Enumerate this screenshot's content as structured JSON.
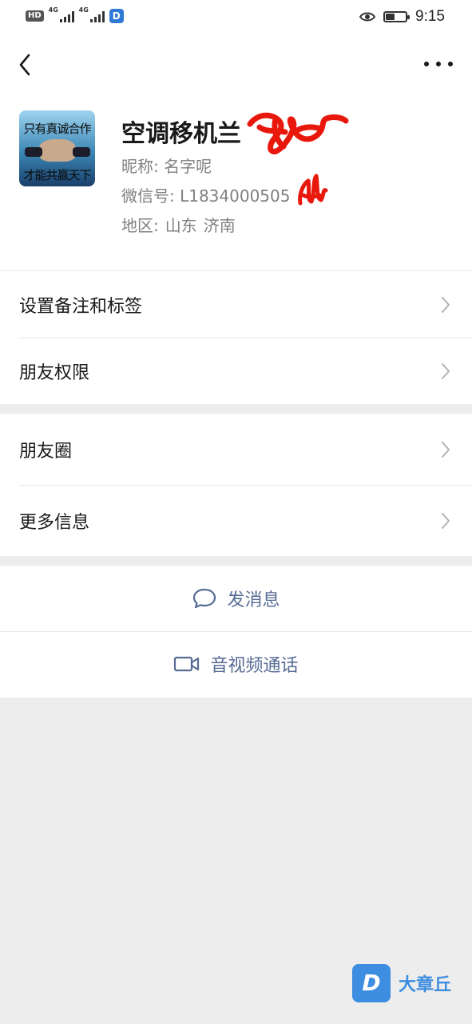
{
  "status_bar": {
    "hd_badge": "HD",
    "signal_1_label": "4G",
    "signal_2_label": "4G",
    "app_badge": "D",
    "battery_level": 0.45,
    "time": "9:15"
  },
  "nav": {
    "back_icon": "chevron-left-icon",
    "more_icon": "more-dots-icon"
  },
  "profile": {
    "avatar_text_top": "只有真诚合作",
    "avatar_text_bottom": "才能共赢天下",
    "name": "空调移机兰",
    "nickname": "昵称:  名字呢",
    "wechat_id": "微信号:  L1834000505",
    "region_label": "地区:",
    "region_province": "山东",
    "region_city": "济南"
  },
  "menu_group_1": [
    {
      "label": "设置备注和标签"
    },
    {
      "label": "朋友权限"
    }
  ],
  "menu_group_2": [
    {
      "label": "朋友圈"
    },
    {
      "label": "更多信息"
    }
  ],
  "actions": {
    "send_message": "发消息",
    "av_call": "音视频通话"
  },
  "watermark": {
    "logo_letter": "D",
    "text": "大章丘"
  },
  "colors": {
    "link_blue": "#576b95",
    "background": "#ededed",
    "scribble_red": "#e8180c"
  }
}
